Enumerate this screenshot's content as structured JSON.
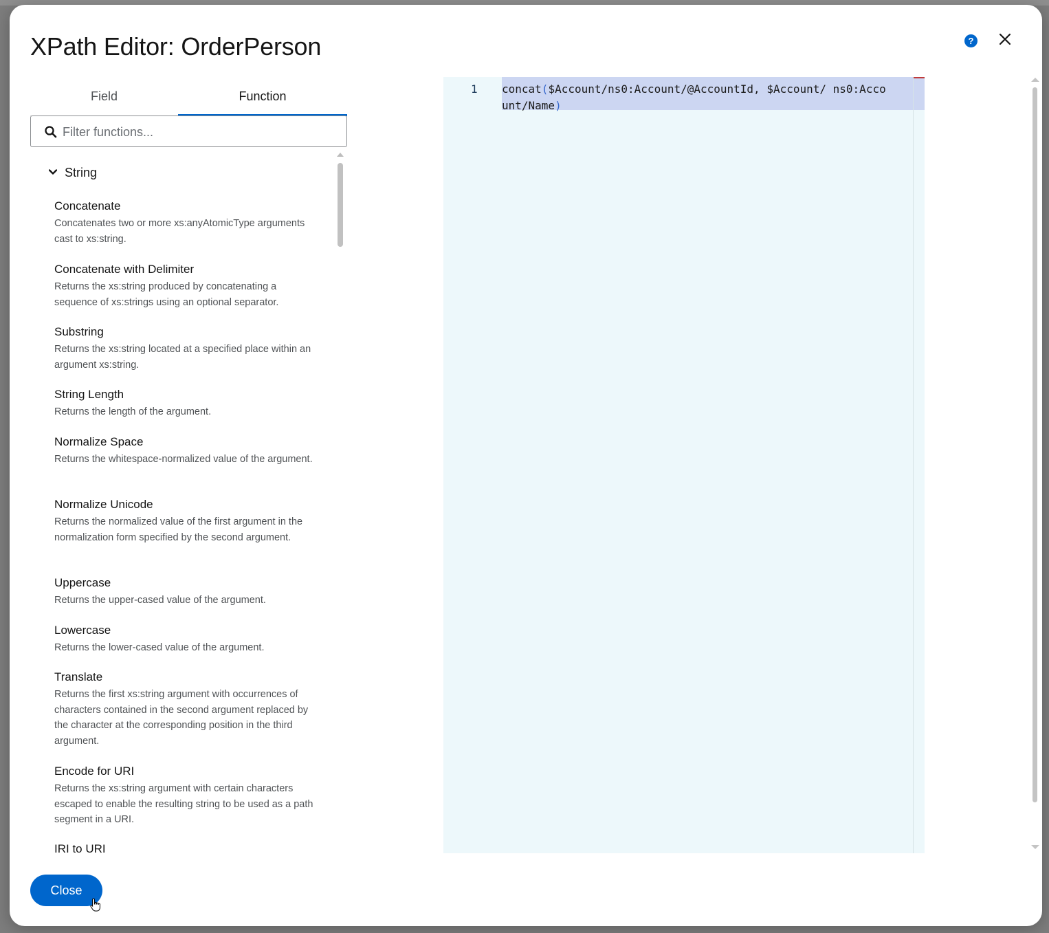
{
  "dialog": {
    "title": "XPath Editor: OrderPerson",
    "help_icon": "help-circle-icon",
    "close_icon": "close-icon"
  },
  "tabs": [
    {
      "label": "Field",
      "active": false
    },
    {
      "label": "Function",
      "active": true
    }
  ],
  "search": {
    "placeholder": "Filter functions...",
    "value": ""
  },
  "function_group": {
    "label": "String",
    "expanded": true,
    "items": [
      {
        "name": "Concatenate",
        "desc": "Concatenates two or more xs:anyAtomicType arguments cast to xs:string."
      },
      {
        "name": "Concatenate with Delimiter",
        "desc": "Returns the xs:string produced by concatenating a sequence of xs:strings using an optional separator."
      },
      {
        "name": "Substring",
        "desc": "Returns the xs:string located at a specified place within an argument xs:string."
      },
      {
        "name": "String Length",
        "desc": "Returns the length of the argument."
      },
      {
        "name": "Normalize Space",
        "desc": "Returns the whitespace-normalized value of the argument."
      },
      {
        "name": "Normalize Unicode",
        "desc": "Returns the normalized value of the first argument in the normalization form specified by the second argument."
      },
      {
        "name": "Uppercase",
        "desc": "Returns the upper-cased value of the argument."
      },
      {
        "name": "Lowercase",
        "desc": "Returns the lower-cased value of the argument."
      },
      {
        "name": "Translate",
        "desc": "Returns the first xs:string argument with occurrences of characters contained in the second argument replaced by the character at the corresponding position in the third argument."
      },
      {
        "name": "Encode for URI",
        "desc": "Returns the xs:string argument with certain characters escaped to enable the resulting string to be used as a path segment in a URI."
      },
      {
        "name": "IRI to URI",
        "desc": ""
      }
    ]
  },
  "editor": {
    "line_number": "1",
    "code_fn": "concat",
    "code_open": "(",
    "code_args": "$Account/ns0:Account/@AccountId, $Account/ ns0:Account/Name",
    "code_close": ")"
  },
  "footer": {
    "close_label": "Close"
  },
  "colors": {
    "accent": "#0066cc",
    "editor_bg": "#edf8fb",
    "selection": "#ccd6f2"
  }
}
